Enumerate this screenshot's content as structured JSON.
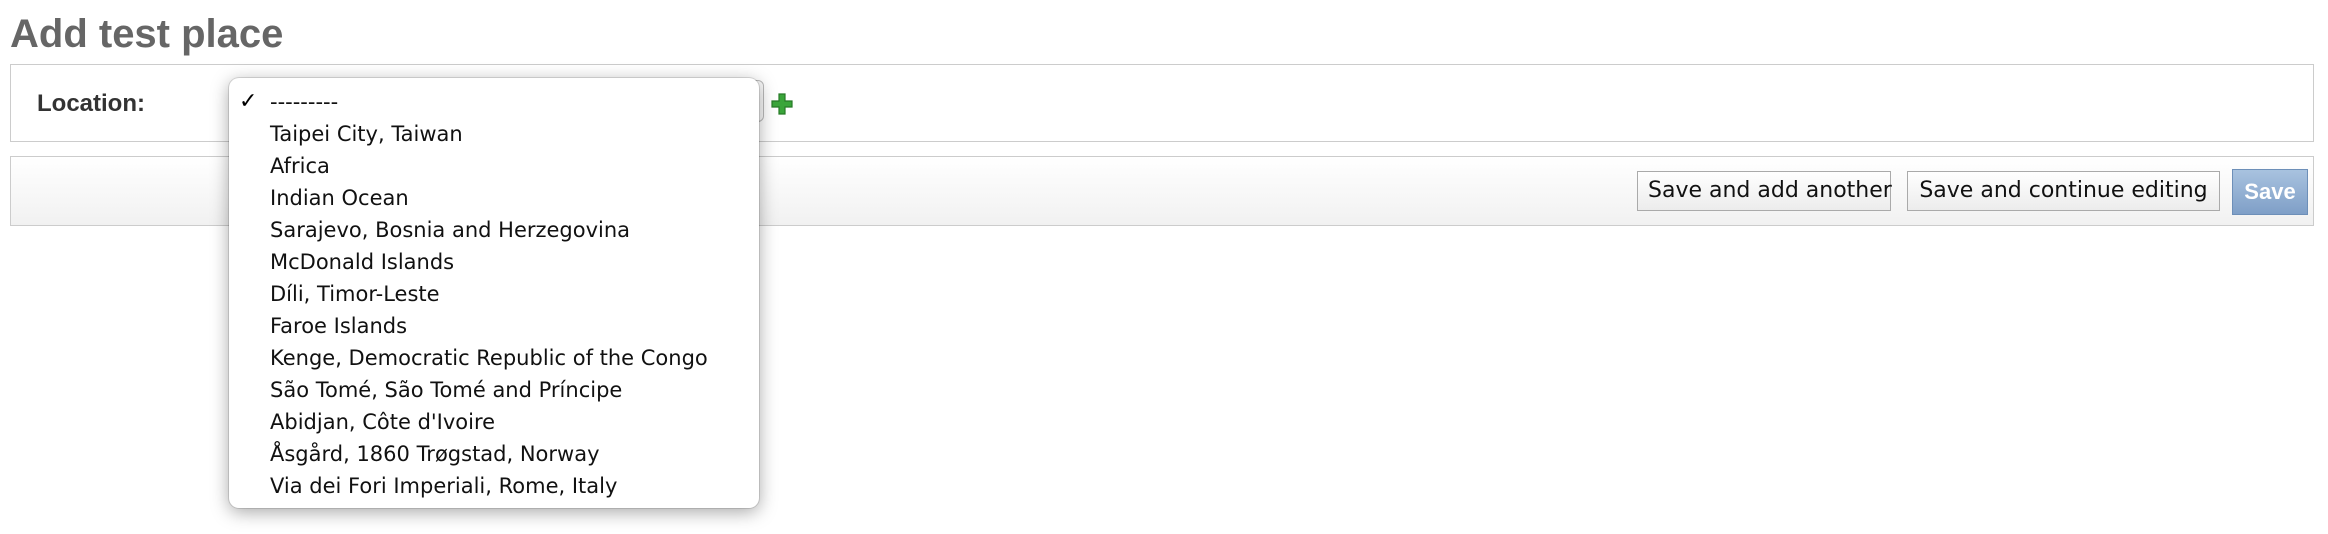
{
  "page": {
    "title": "Add test place"
  },
  "form": {
    "location_label": "Location:",
    "location_selected": "---------",
    "location_options": [
      "---------",
      "Taipei City, Taiwan",
      "Africa",
      "Indian Ocean",
      "Sarajevo, Bosnia and Herzegovina",
      "McDonald Islands",
      "Díli, Timor-Leste",
      "Faroe Islands",
      "Kenge, Democratic Republic of the Congo",
      "São Tomé, São Tomé and Príncipe",
      "Abidjan, Côte d'Ivoire",
      "Åsgård, 1860 Trøgstad, Norway",
      "Via dei Fori Imperiali, Rome, Italy"
    ],
    "checkmark": "✓",
    "add_icon": "plus-icon"
  },
  "submit_row": {
    "save_add_another": "Save and add another",
    "save_continue": "Save and continue editing",
    "save": "Save"
  },
  "colors": {
    "title": "#666666",
    "add_icon": "#3aa53a",
    "save_button": "#7f9fc7"
  }
}
